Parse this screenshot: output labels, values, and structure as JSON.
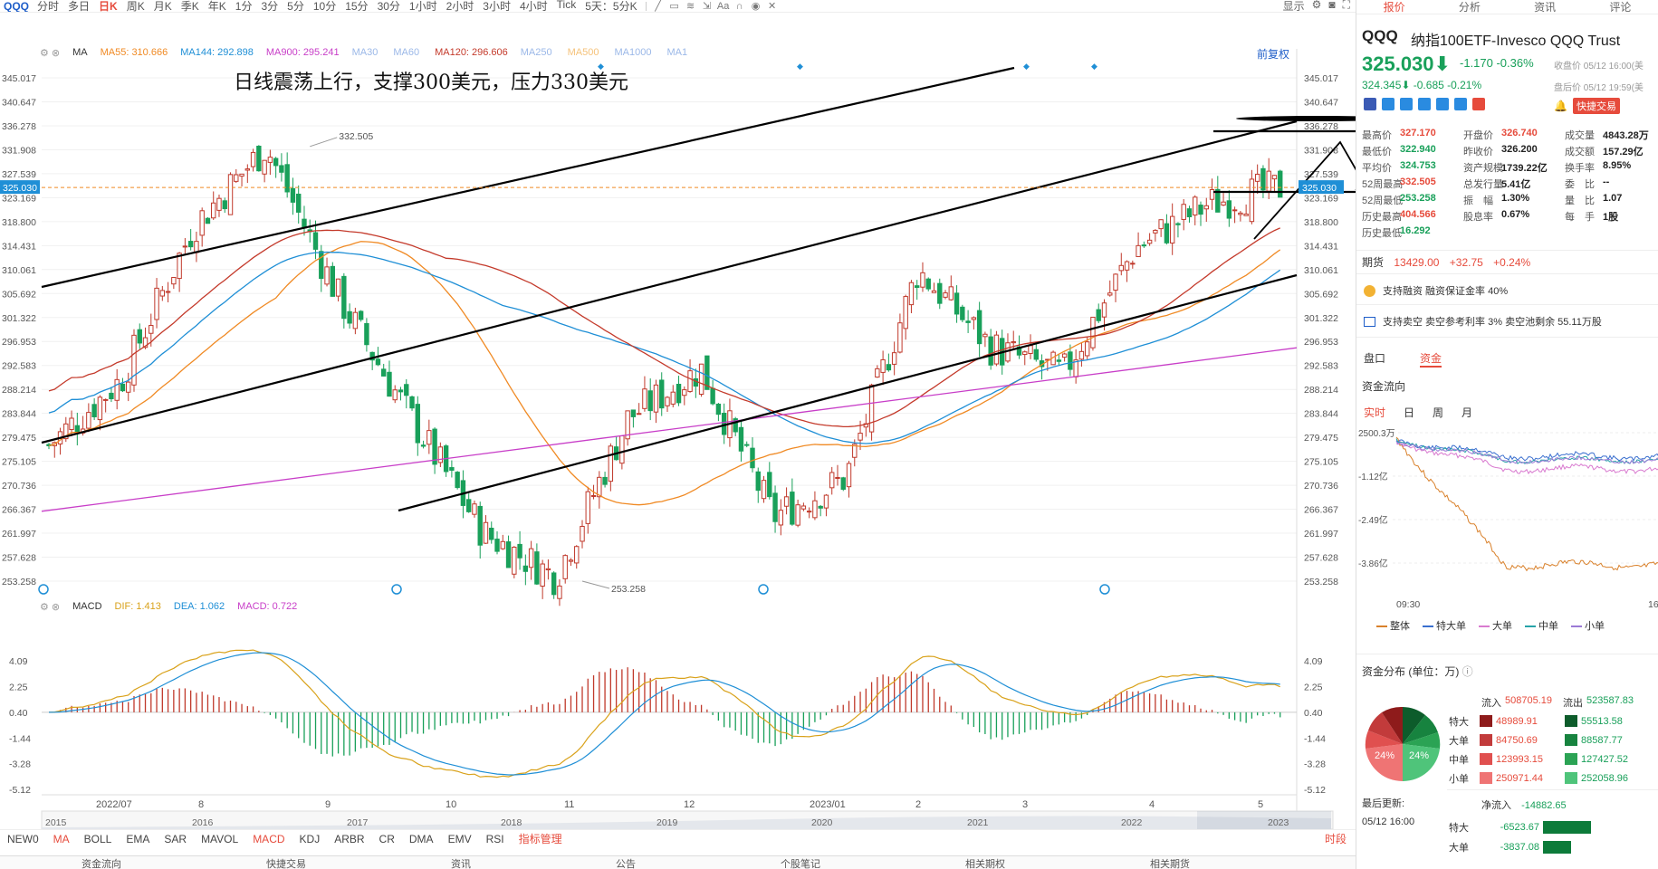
{
  "toolbar": {
    "symbol": "QQQ",
    "periods": [
      "分时",
      "多日",
      "日K",
      "周K",
      "月K",
      "季K",
      "年K",
      "1分",
      "3分",
      "5分",
      "10分",
      "15分",
      "30分",
      "1小时",
      "2小时",
      "3小时",
      "4小时",
      "Tick",
      "5天：5分K"
    ],
    "active_period": "日K",
    "display_label": "显示"
  },
  "legend": {
    "ma_label": "MA",
    "items": [
      {
        "name": "MA55:",
        "value": "310.666",
        "color": "#f08a24"
      },
      {
        "name": "MA144:",
        "value": "292.898",
        "color": "#1f8fd6"
      },
      {
        "name": "MA900:",
        "value": "295.241",
        "color": "#c83ec8"
      },
      {
        "name": "MA30",
        "value": "",
        "color": "#9bb8e8"
      },
      {
        "name": "MA60",
        "value": "",
        "color": "#9bb8e8"
      },
      {
        "name": "MA120:",
        "value": "296.606",
        "color": "#c43a2b"
      },
      {
        "name": "MA250",
        "value": "",
        "color": "#9bb8e8"
      },
      {
        "name": "MA500",
        "value": "",
        "color": "#f5c27a"
      },
      {
        "name": "MA1000",
        "value": "",
        "color": "#9bb8e8"
      },
      {
        "name": "MA1",
        "value": "",
        "color": "#9bb8e8"
      }
    ],
    "fuquan": "前复权"
  },
  "annotation": "日线震荡上行，支撑300美元，压力330美元",
  "macd_legend": {
    "name": "MACD",
    "dif": "DIF: 1.413",
    "dea": "DEA: 1.062",
    "macd": "MACD: 0.722"
  },
  "price_axis": [
    "345.017",
    "340.647",
    "336.278",
    "331.908",
    "327.539",
    "323.169",
    "318.800",
    "314.431",
    "310.061",
    "305.692",
    "301.322",
    "296.953",
    "292.583",
    "288.214",
    "283.844",
    "279.475",
    "275.105",
    "270.736",
    "266.367",
    "261.997",
    "257.628",
    "253.258"
  ],
  "price_axis_left": [
    "345.017",
    "340.647",
    "336.278",
    "331.908",
    "327.539",
    "323.169",
    "318.800",
    "314.431",
    "310.061",
    "305.692",
    "301.322",
    "296.953",
    "292.583",
    "288.214",
    "283.844",
    "279.475",
    "275.105",
    "270.736",
    "266.367",
    "261.997",
    "257.628",
    "253.258"
  ],
  "current_price_tag": "325.030",
  "high_mark": "332.505",
  "low_mark": "253.258",
  "macd_axis": [
    "4.09",
    "2.25",
    "0.40",
    "-1.44",
    "-3.28",
    "-5.12"
  ],
  "macd_axis_right": [
    "4.09",
    "2.25",
    "0.40",
    "-1.44",
    "-3.28",
    "-5.12"
  ],
  "date_axis": [
    "2022/07",
    "8",
    "9",
    "10",
    "11",
    "12",
    "2023/01",
    "2",
    "3",
    "4",
    "5"
  ],
  "overview_years": [
    "2015",
    "2016",
    "2017",
    "2018",
    "2019",
    "2020",
    "2021",
    "2022",
    "2023"
  ],
  "indicators": [
    "NEW0",
    "MA",
    "BOLL",
    "EMA",
    "SAR",
    "MAVOL",
    "MACD",
    "KDJ",
    "ARBR",
    "CR",
    "DMA",
    "EMV",
    "RSI"
  ],
  "indicator_manage": "指标管理",
  "indicator_right": "时段",
  "bottom_tabs": [
    "资金流向",
    "快捷交易",
    "资讯",
    "公告",
    "个股笔记",
    "相关期权",
    "相关期货"
  ],
  "panel": {
    "tabs": [
      "报价",
      "分析",
      "资讯",
      "评论"
    ],
    "symbol": "QQQ",
    "name": "纳指100ETF-Invesco QQQ Trust",
    "price": "325.030",
    "arrow": "⬇",
    "change": "-1.170  -0.36%",
    "close_time": "收盘价 05/12 16:00(美",
    "post_price": "324.345⬇  -0.685  -0.21%",
    "post_time": "盘后价 05/12 19:59(美",
    "quick_trade": "快捷交易",
    "stats": [
      [
        {
          "l": "最高价",
          "v": "327.170",
          "c": "red"
        },
        {
          "l": "开盘价",
          "v": "326.740",
          "c": "red"
        },
        {
          "l": "成交量",
          "v": "4843.28万",
          "c": "dark"
        }
      ],
      [
        {
          "l": "最低价",
          "v": "322.940",
          "c": "green"
        },
        {
          "l": "昨收价",
          "v": "326.200",
          "c": "dark"
        },
        {
          "l": "成交额",
          "v": "157.29亿",
          "c": "dark"
        }
      ],
      [
        {
          "l": "平均价",
          "v": "324.753",
          "c": "green"
        },
        {
          "l": "资产规模",
          "v": "1739.22亿",
          "c": "dark"
        },
        {
          "l": "换手率",
          "v": "8.95%",
          "c": "dark"
        }
      ],
      [
        {
          "l": "52周最高",
          "v": "332.505",
          "c": "red"
        },
        {
          "l": "总发行量",
          "v": "5.41亿",
          "c": "dark"
        },
        {
          "l": "委　比",
          "v": "--",
          "c": "dark"
        }
      ],
      [
        {
          "l": "52周最低",
          "v": "253.258",
          "c": "green"
        },
        {
          "l": "振　幅",
          "v": "1.30%",
          "c": "dark"
        },
        {
          "l": "量　比",
          "v": "1.07",
          "c": "dark"
        }
      ],
      [
        {
          "l": "历史最高",
          "v": "404.566",
          "c": "red"
        },
        {
          "l": "股息率",
          "v": "0.67%",
          "c": "dark"
        },
        {
          "l": "每　手",
          "v": "1股",
          "c": "dark"
        }
      ],
      [
        {
          "l": "历史最低",
          "v": "16.292",
          "c": "green"
        }
      ]
    ],
    "futures_label": "期货",
    "futures_price": "13429.00",
    "futures_chg": "+32.75",
    "futures_pct": "+0.24%",
    "margin": "支持融资  融资保证金率 40%",
    "short": "支持卖空  卖空参考利率 3%  卖空池剩余 55.11万股",
    "section_tabs": [
      "盘口",
      "资金"
    ],
    "flow_title": "资金流向",
    "flow_tabs": [
      "实时",
      "日",
      "周",
      "月"
    ],
    "flow_axis": [
      "2500.3万",
      "-1.12亿",
      "-2.49亿",
      "-3.86亿"
    ],
    "flow_time_start": "09:30",
    "flow_time_end": "16",
    "flow_legend": [
      {
        "name": "整体",
        "color": "#d9812b"
      },
      {
        "name": "特大单",
        "color": "#3a6fcf"
      },
      {
        "name": "大单",
        "color": "#d97bd0"
      },
      {
        "name": "中单",
        "color": "#27a3a8"
      },
      {
        "name": "小单",
        "color": "#9b7ad6"
      }
    ],
    "dist_title": "资金分布 (单位：万)",
    "inflow_label": "流入",
    "inflow_total": "508705.19",
    "outflow_label": "流出",
    "outflow_total": "523587.83",
    "pie_left": "24%",
    "pie_right": "24%",
    "dist_rows": [
      {
        "l": "特大",
        "in": "48989.91",
        "out": "55513.58",
        "ci": "#8e1b1b",
        "co": "#0d5c2b"
      },
      {
        "l": "大单",
        "in": "84750.69",
        "out": "88587.77",
        "ci": "#c23b3b",
        "co": "#17833f"
      },
      {
        "l": "中单",
        "in": "123993.15",
        "out": "127427.52",
        "ci": "#e0504f",
        "co": "#2ba354"
      },
      {
        "l": "小单",
        "in": "250971.44",
        "out": "252058.96",
        "ci": "#ef7474",
        "co": "#4fc47a"
      }
    ],
    "update_label": "最后更新:",
    "update_time": "05/12 16:00",
    "net_label": "净流入",
    "net_value": "-14882.65",
    "net_rows": [
      {
        "l": "特大",
        "v": "-6523.67",
        "w": 0.44
      },
      {
        "l": "大单",
        "v": "-3837.08",
        "w": 0.26
      }
    ]
  },
  "chart_data": {
    "type": "candlestick",
    "title": "",
    "ylim": [
      253.258,
      345.017
    ],
    "x_range": [
      "2022/06",
      "2023/05"
    ],
    "current_price": 325.03,
    "high_52w": 332.505,
    "low_52w": 253.258,
    "ma": {
      "MA55": 310.666,
      "MA144": 292.898,
      "MA900": 295.241,
      "MA120": 296.606
    },
    "anchors": [
      {
        "date": "2022/06",
        "close": 278
      },
      {
        "date": "2022/07",
        "close": 290
      },
      {
        "date": "2022/08",
        "close": 318
      },
      {
        "date": "2022/08",
        "close": 332.5
      },
      {
        "date": "2022/09",
        "close": 305
      },
      {
        "date": "2022/09",
        "close": 283
      },
      {
        "date": "2022/10",
        "close": 262
      },
      {
        "date": "2022/10",
        "close": 254
      },
      {
        "date": "2022/11",
        "close": 283
      },
      {
        "date": "2022/12",
        "close": 292
      },
      {
        "date": "2022/12",
        "close": 265
      },
      {
        "date": "2023/01",
        "close": 272
      },
      {
        "date": "2023/02",
        "close": 310
      },
      {
        "date": "2023/02",
        "close": 296
      },
      {
        "date": "2023/03",
        "close": 291
      },
      {
        "date": "2023/03",
        "close": 314
      },
      {
        "date": "2023/04",
        "close": 322
      },
      {
        "date": "2023/05",
        "close": 325.03
      }
    ],
    "macd": {
      "dif": 1.413,
      "dea": 1.062,
      "macd": 0.722,
      "ylim": [
        -5.12,
        4.09
      ]
    }
  }
}
